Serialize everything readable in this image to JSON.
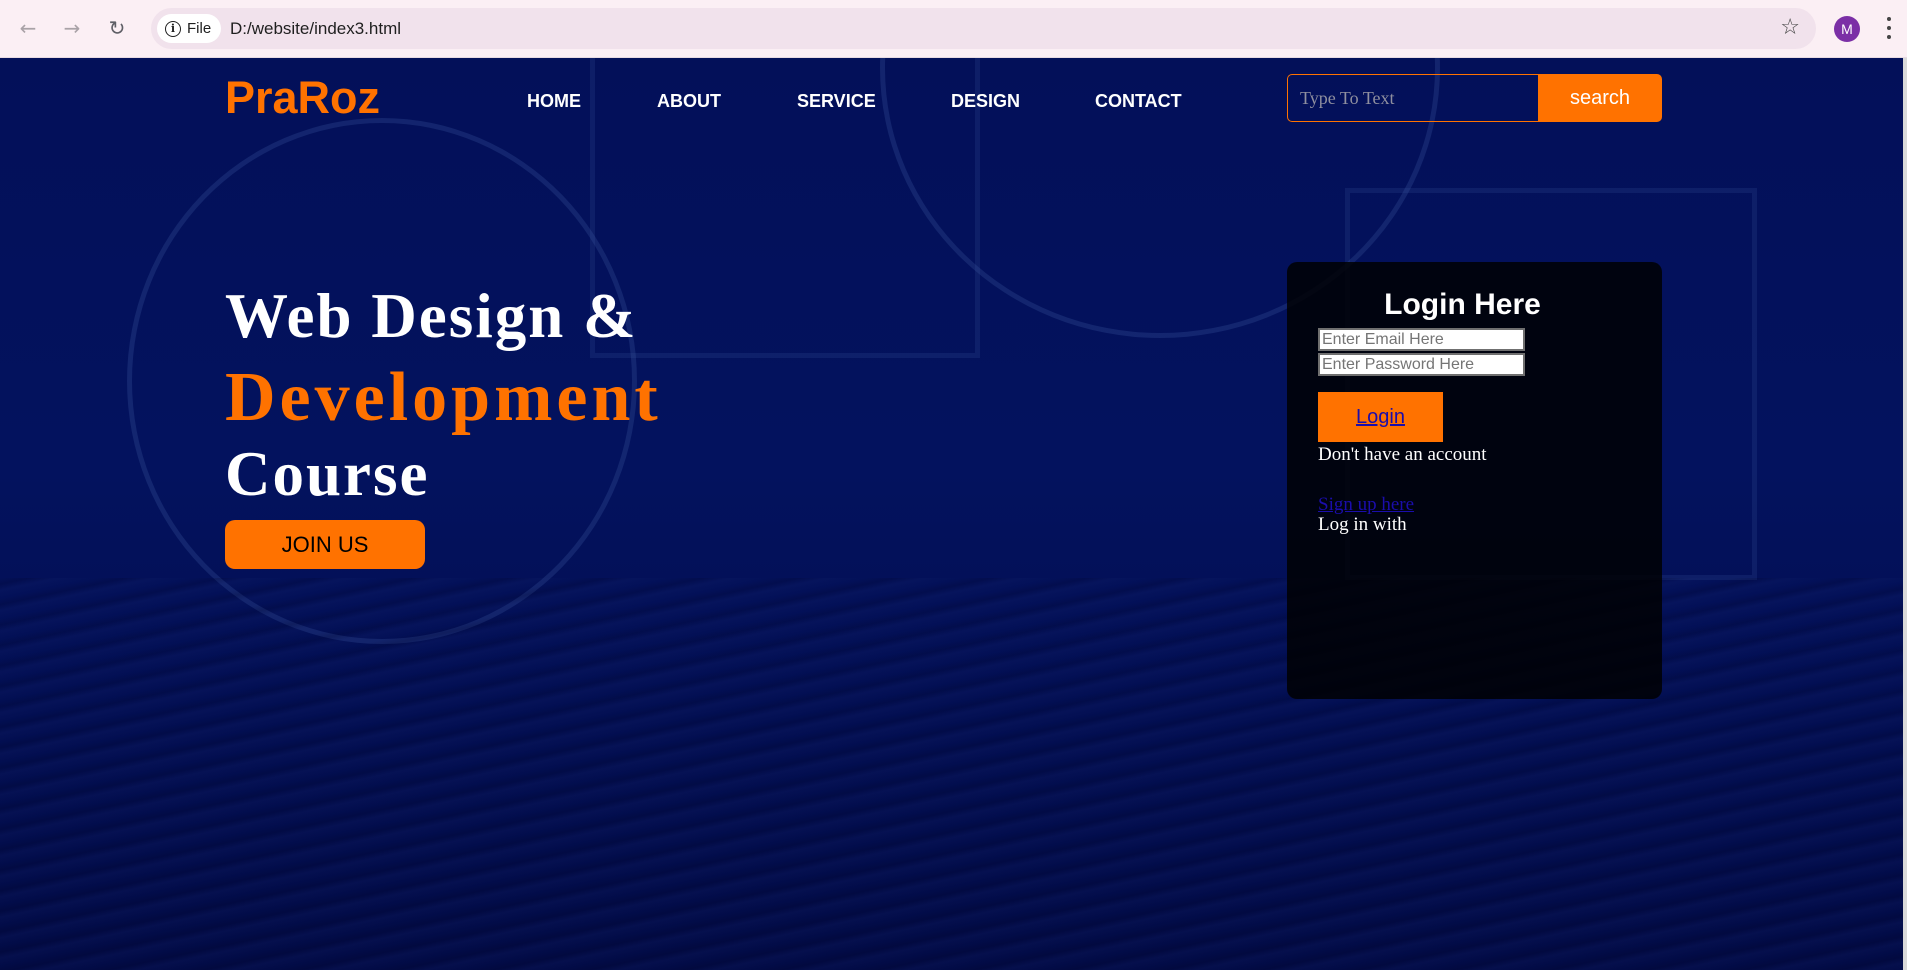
{
  "browser": {
    "file_chip_label": "File",
    "url": "D:/website/index3.html",
    "profile_initial": "M"
  },
  "header": {
    "logo": "PraRoz",
    "nav_items": [
      "HOME",
      "ABOUT",
      "SERVICE",
      "DESIGN",
      "CONTACT"
    ],
    "search_placeholder": "Type To Text",
    "search_button": "search"
  },
  "hero": {
    "line1": "Web Design &",
    "line2": "Development",
    "line3": "Course",
    "join_button": "JOIN US"
  },
  "login": {
    "title": "Login Here",
    "email_placeholder": "Enter Email Here",
    "password_placeholder": "Enter Password Here",
    "login_button": "Login",
    "no_account_text": "Don't have an account",
    "signup_link": "Sign up here",
    "login_with_text": "Log in with"
  },
  "colors": {
    "accent": "#ff7200",
    "background": "#031059",
    "panel": "#000000"
  }
}
